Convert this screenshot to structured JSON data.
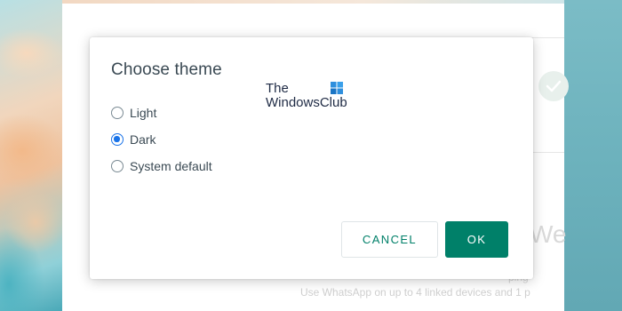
{
  "dialog": {
    "title": "Choose theme",
    "options": [
      {
        "label": "Light",
        "selected": false
      },
      {
        "label": "Dark",
        "selected": true
      },
      {
        "label": "System default",
        "selected": false
      }
    ],
    "cancel_label": "CANCEL",
    "ok_label": "OK"
  },
  "watermark": {
    "line1": "The",
    "line2": "WindowsClub"
  },
  "background_app": {
    "heading": "We",
    "line1": "ping",
    "line2": "Use WhatsApp on up to 4 linked devices and 1 p"
  },
  "colors": {
    "accent_green": "#008069",
    "radio_selected": "#1a73e8",
    "text": "#3b4a54"
  },
  "icons": [
    "check-icon",
    "windows-logo-icon"
  ]
}
